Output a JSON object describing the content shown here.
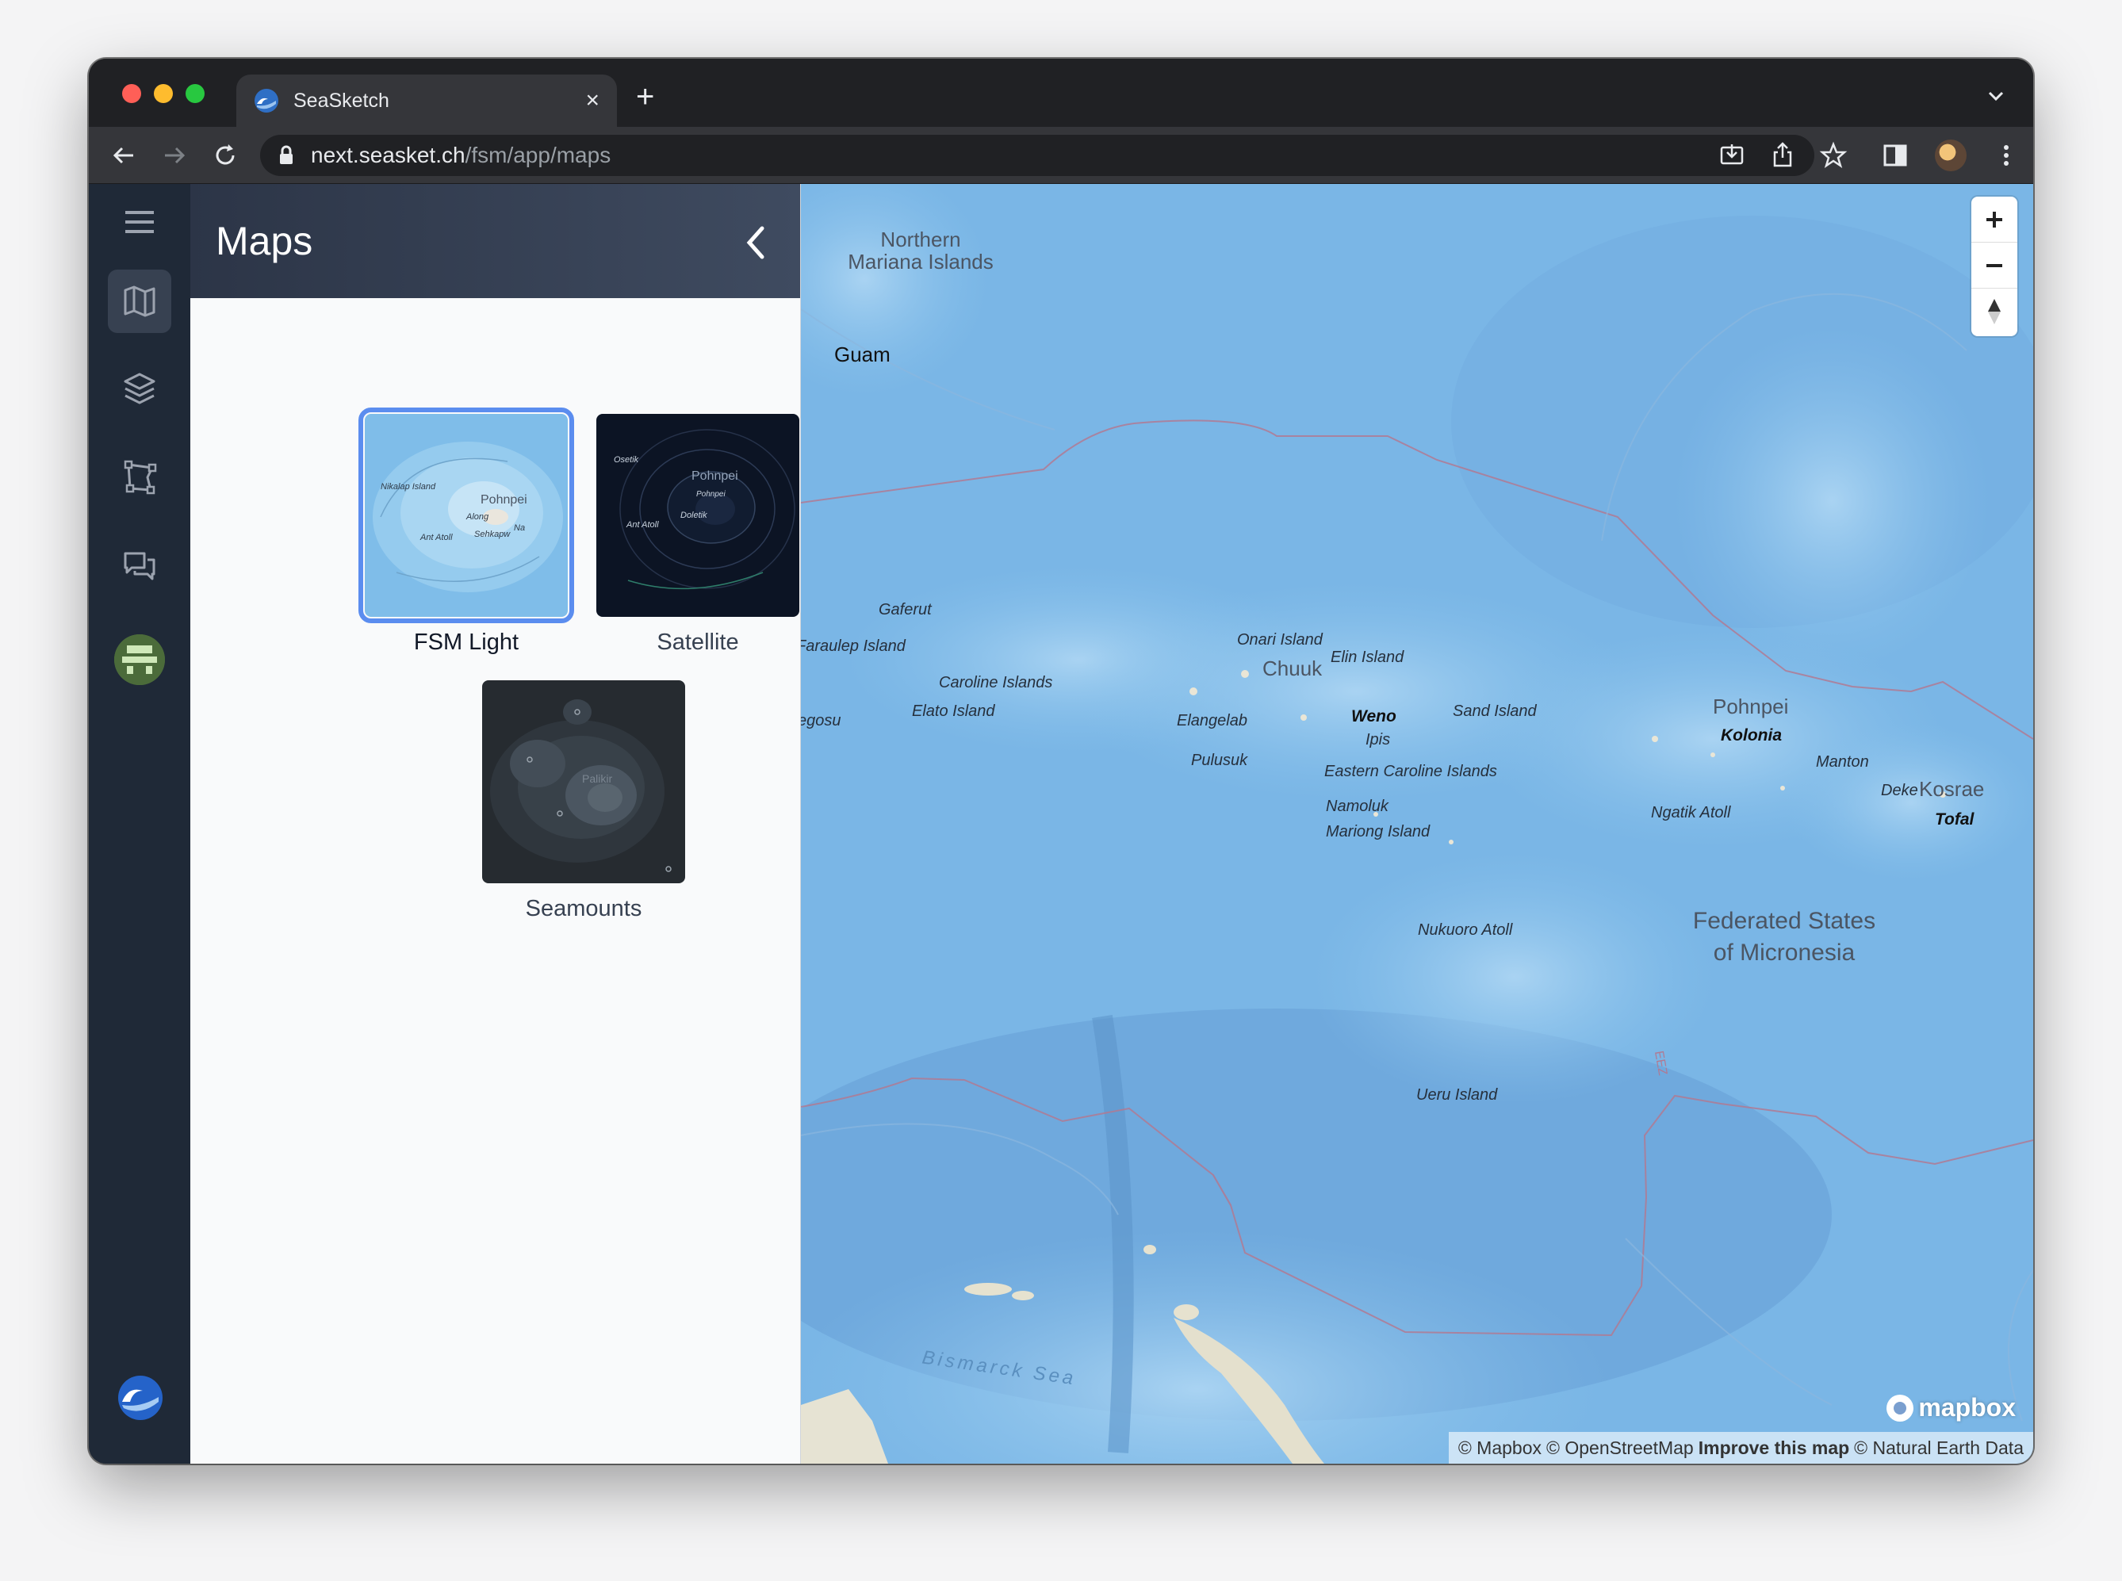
{
  "browser": {
    "tab_title": "SeaSketch",
    "url_host": "next.seasket.ch",
    "url_path": "/fsm/app/maps"
  },
  "sidebar": {
    "items": [
      {
        "name": "menu-icon"
      },
      {
        "name": "map-icon",
        "active": true
      },
      {
        "name": "layers-icon"
      },
      {
        "name": "sketch-icon"
      },
      {
        "name": "discussion-icon"
      }
    ]
  },
  "panel": {
    "title": "Maps",
    "basemaps": [
      {
        "label": "FSM Light",
        "selected": true
      },
      {
        "label": "Satellite",
        "selected": false
      },
      {
        "label": "Seamounts",
        "selected": false
      }
    ],
    "fsm_light_thumb": {
      "labels": [
        "Nikalap Island",
        "Pohnpei",
        "Along",
        "Na",
        "Ant Atoll",
        "Sehkapw"
      ]
    },
    "satellite_thumb": {
      "labels": [
        "Osetik",
        "Pohnpei",
        "Pohnpei",
        "Doletik",
        "Ant Atoll"
      ]
    },
    "seamounts_thumb": {
      "labels": [
        "Palikir"
      ]
    }
  },
  "map": {
    "labels": {
      "northern_mariana": "Northern Mariana Islands",
      "guam": "Guam",
      "gaferut": "Gaferut",
      "faraulep": "Faraulep Island",
      "caroline_islands": "Caroline Islands",
      "elato": "Elato Island",
      "egosu": "egosu",
      "onari": "Onari Island",
      "chuuk": "Chuuk",
      "elin": "Elin Island",
      "elangelab": "Elangelab",
      "weno": "Weno",
      "ipis": "Ipis",
      "pulusuk": "Pulusuk",
      "sand_island": "Sand Island",
      "pohnpei": "Pohnpei",
      "kolonia": "Kolonia",
      "manton": "Manton",
      "deke": "Deke",
      "eastern_caroline": "Eastern Caroline Islands",
      "namoluk": "Namoluk",
      "mariong": "Mariong Island",
      "ngatik": "Ngatik Atoll",
      "kosrae": "Kosrae",
      "tofal": "Tofal",
      "fsm_line1": "Federated States",
      "fsm_line2": "of Micronesia",
      "nukuoro": "Nukuoro Atoll",
      "ueru": "Ueru Island",
      "eez": "EEZ",
      "bismarck": "Bismarck Sea"
    },
    "zoom_in": "+",
    "zoom_out": "−",
    "attribution": {
      "mapbox": "© Mapbox",
      "osm": "© OpenStreetMap",
      "improve": "Improve this map",
      "natural_earth": "© Natural Earth Data"
    },
    "logo_text": "mapbox"
  }
}
